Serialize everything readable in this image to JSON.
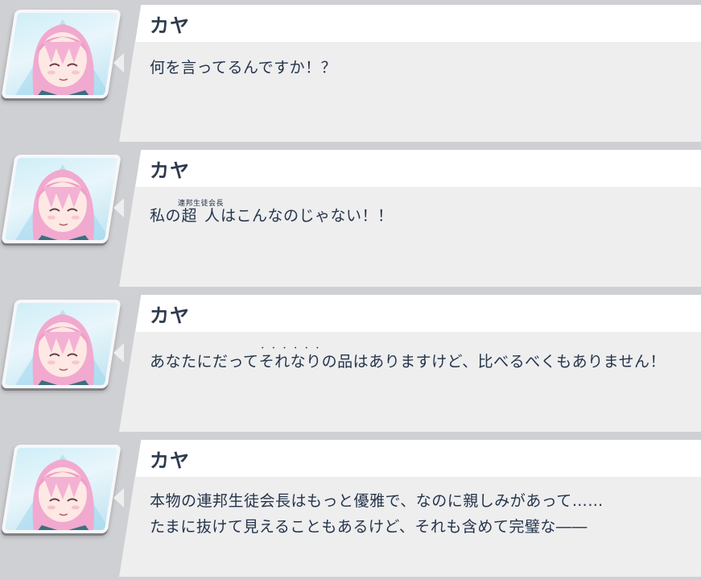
{
  "entries": [
    {
      "speaker": "カヤ",
      "lines": [
        "何を言ってるんですか！？"
      ]
    },
    {
      "speaker": "カヤ",
      "text_before": "私の",
      "ruby_base": "超人",
      "ruby_text": "連邦生徒会長",
      "text_after": "はこんなのじゃない！！"
    },
    {
      "speaker": "カヤ",
      "text_before": "あなたにだって",
      "ruby_base": "それなり",
      "ruby_text": "・ ・ ・ ・ ・ ・",
      "text_after": "の品はありますけど、比べるべくもありません！"
    },
    {
      "speaker": "カヤ",
      "lines": [
        "本物の連邦生徒会長はもっと優雅で、なのに親しみがあって……",
        "たまに抜けて見えることもあるけど、それも含めて完璧な――"
      ]
    }
  ]
}
